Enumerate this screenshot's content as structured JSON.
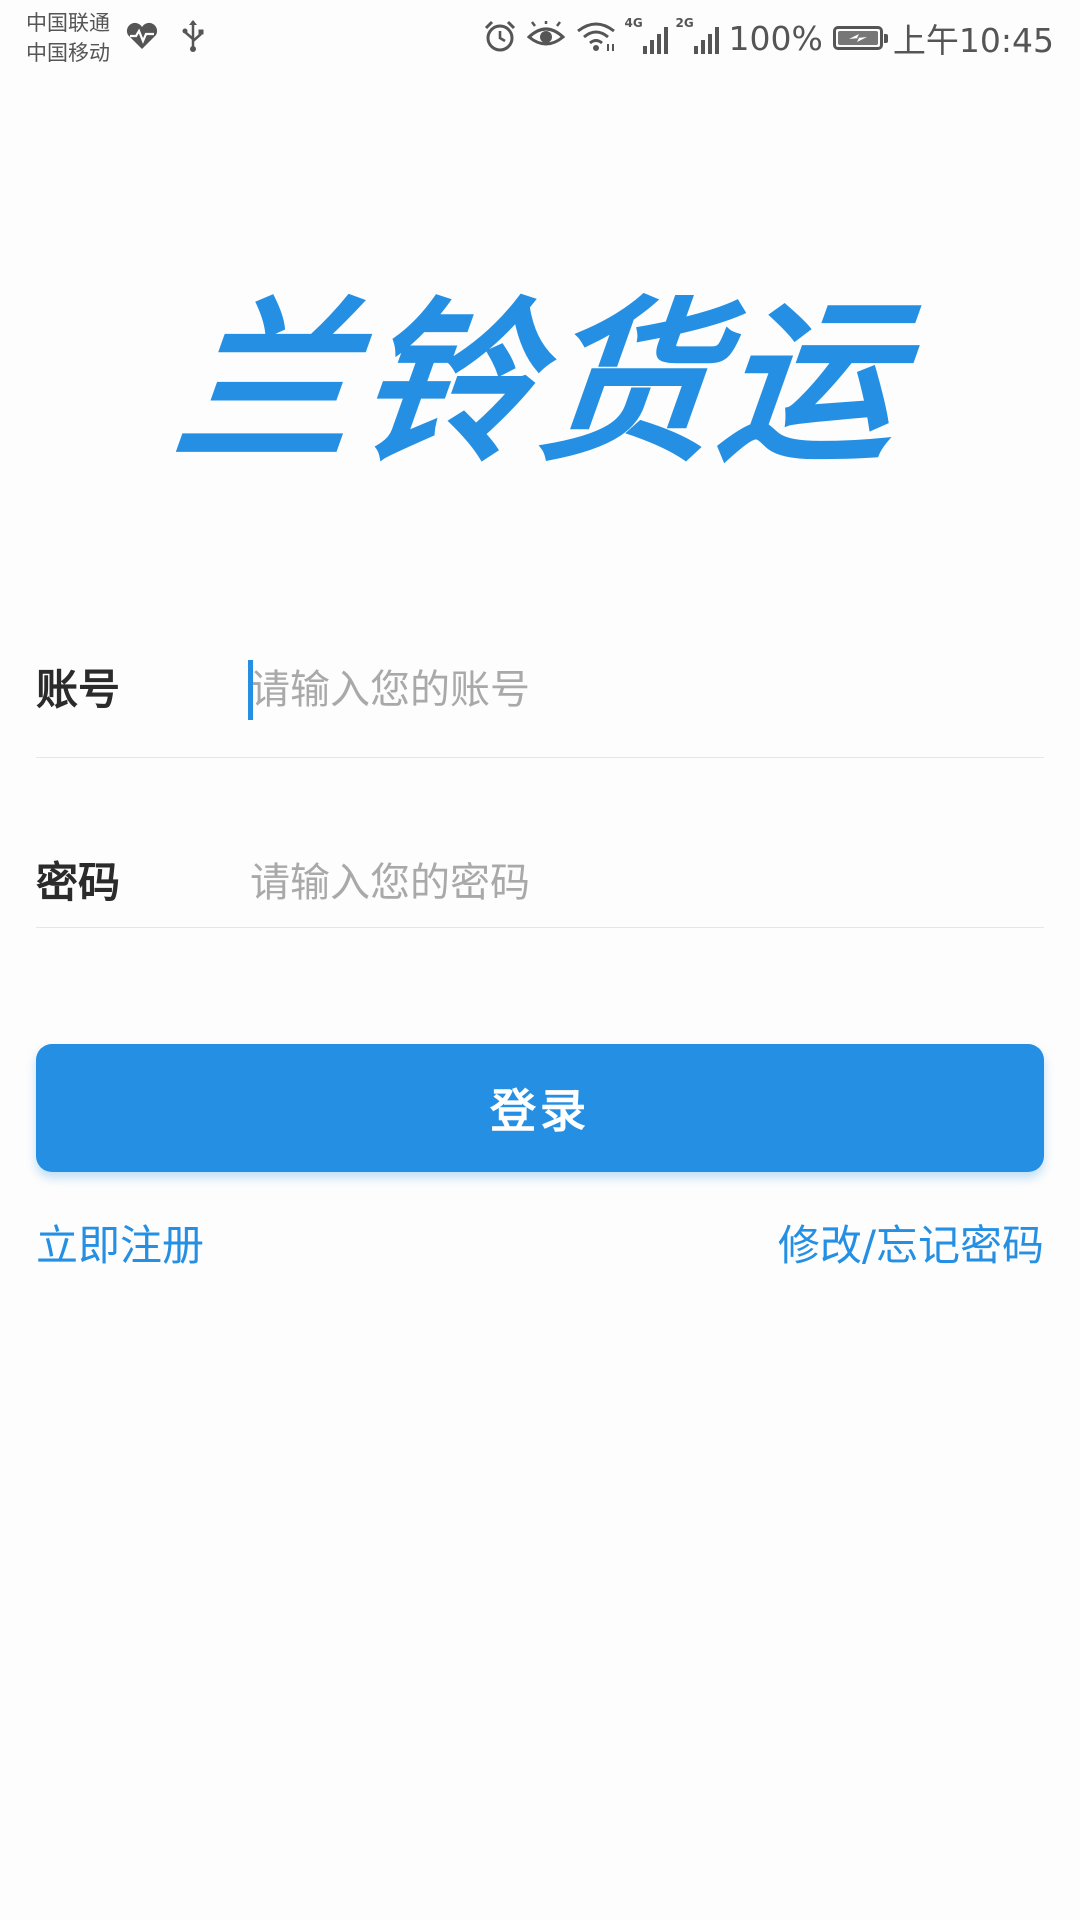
{
  "status_bar": {
    "carrier_1": "中国联通",
    "carrier_2": "中国移动",
    "signal_1_tag": "4G",
    "signal_2_tag": "2G",
    "battery_percent": "100%",
    "time": "上午10:45",
    "icons": [
      "heart-rate-icon",
      "usb-icon",
      "alarm-icon",
      "eye-icon",
      "wifi-icon",
      "signal-4g-icon",
      "signal-2g-icon",
      "battery-charging-icon"
    ]
  },
  "logo": {
    "text": "兰铃货运"
  },
  "form": {
    "account_label": "账号",
    "account_placeholder": "请输入您的账号",
    "account_value": "",
    "password_label": "密码",
    "password_placeholder": "请输入您的密码",
    "password_value": ""
  },
  "actions": {
    "login_label": "登录",
    "register_label": "立即注册",
    "forgot_label": "修改/忘记密码"
  },
  "colors": {
    "accent": "#2590e3",
    "label": "#2b2b2b",
    "placeholder": "#a9a9a9",
    "divider": "#e6e6e6",
    "background": "#fdfdfd"
  }
}
